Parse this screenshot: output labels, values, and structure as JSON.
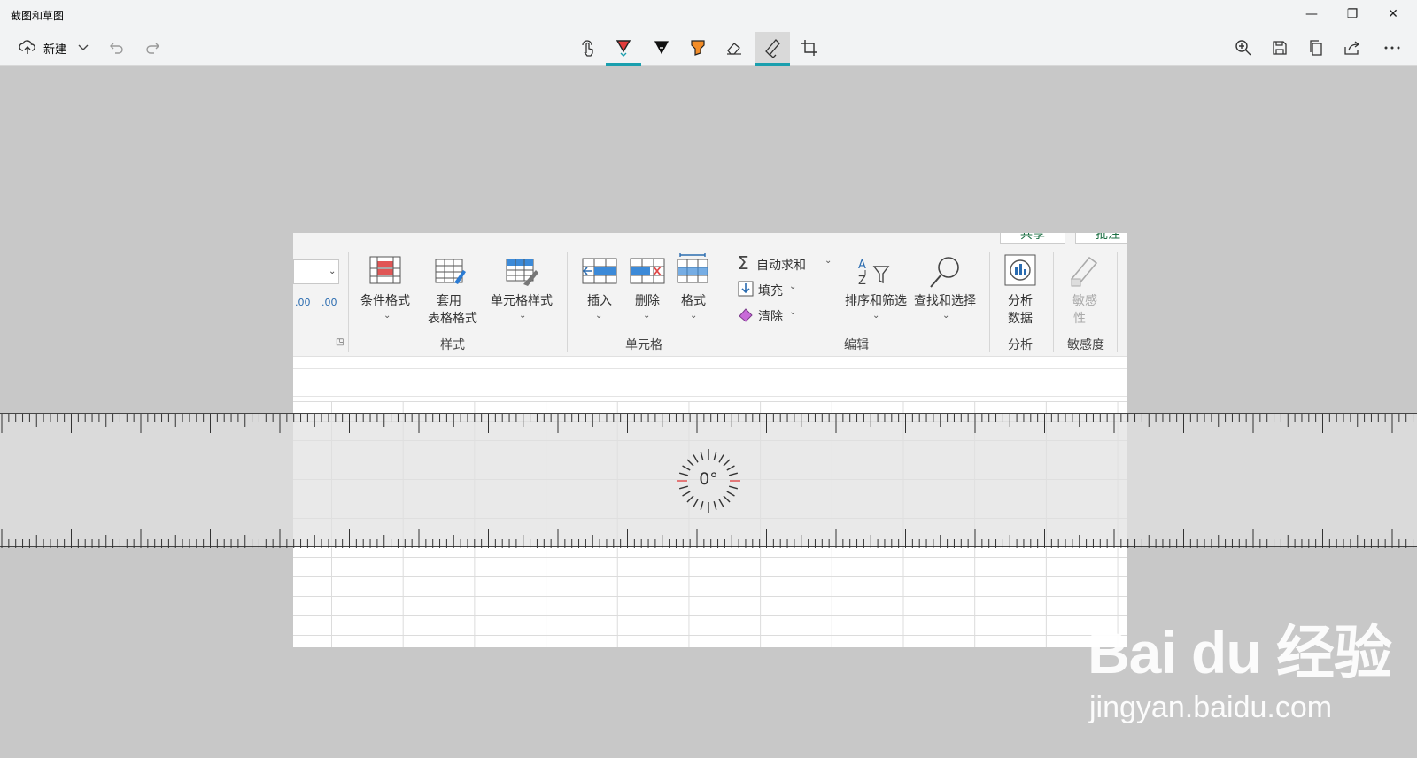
{
  "app": {
    "title": "截图和草图"
  },
  "window_controls": {
    "minimize": "—",
    "restore": "❐",
    "close": "✕"
  },
  "toolbar": {
    "new_label": "新建",
    "accent_color": "#1a9fae",
    "tools": [
      "touch-writing-icon",
      "ballpoint-pen-icon",
      "pencil-icon",
      "highlighter-icon",
      "eraser-icon",
      "ruler-icon",
      "crop-icon"
    ],
    "right_tools": [
      "zoom-icon",
      "save-icon",
      "copy-icon",
      "share-icon",
      "more-icon"
    ]
  },
  "embedded": {
    "top_buttons": [
      "共享",
      "批注"
    ],
    "styles": {
      "conditional_format": "条件格式",
      "table_format_1": "套用",
      "table_format_2": "表格格式",
      "cell_styles": "单元格样式",
      "group": "样式"
    },
    "cells": {
      "insert": "插入",
      "delete": "删除",
      "format": "格式",
      "group": "单元格"
    },
    "editing": {
      "autosum": "自动求和",
      "fill": "填充",
      "clear": "清除",
      "sort_filter": "排序和筛选",
      "find_select": "查找和选择",
      "group": "编辑"
    },
    "analysis": {
      "analyze_1": "分析",
      "analyze_2": "数据",
      "group": "分析"
    },
    "sensitivity": {
      "label_1": "敏感",
      "label_2": "性",
      "group": "敏感度"
    },
    "decimal": {
      "increase": ".00",
      "decrease": ".00"
    }
  },
  "ruler": {
    "angle": "0°"
  },
  "watermark": {
    "logo": "Bai du 经验",
    "url": "jingyan.baidu.com"
  }
}
